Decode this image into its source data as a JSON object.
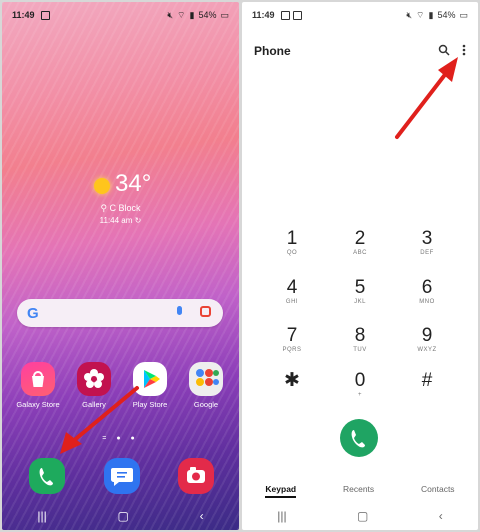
{
  "left": {
    "status": {
      "time": "11:49",
      "battery": "54%"
    },
    "weather": {
      "temp": "34°",
      "location": "C Block",
      "time": "11:44 am"
    },
    "apps": [
      {
        "label": "Galaxy Store",
        "icon": "galaxy-store-icon"
      },
      {
        "label": "Gallery",
        "icon": "gallery-icon"
      },
      {
        "label": "Play Store",
        "icon": "play-store-icon"
      },
      {
        "label": "Google",
        "icon": "google-folder-icon"
      }
    ],
    "dock": [
      {
        "icon": "phone-icon"
      },
      {
        "icon": "messages-icon"
      },
      {
        "icon": "camera-icon"
      }
    ],
    "search": {
      "logo": "G"
    }
  },
  "right": {
    "status": {
      "time": "11:49",
      "battery": "54%"
    },
    "title": "Phone",
    "keys": [
      {
        "num": "1",
        "letters": "QO"
      },
      {
        "num": "2",
        "letters": "ABC"
      },
      {
        "num": "3",
        "letters": "DEF"
      },
      {
        "num": "4",
        "letters": "GHI"
      },
      {
        "num": "5",
        "letters": "JKL"
      },
      {
        "num": "6",
        "letters": "MNO"
      },
      {
        "num": "7",
        "letters": "PQRS"
      },
      {
        "num": "8",
        "letters": "TUV"
      },
      {
        "num": "9",
        "letters": "WXYZ"
      },
      {
        "num": "✱",
        "letters": ""
      },
      {
        "num": "0",
        "letters": "+"
      },
      {
        "num": "#",
        "letters": ""
      }
    ],
    "tabs": [
      "Keypad",
      "Recents",
      "Contacts"
    ]
  },
  "colors": {
    "accent": "#e0201c",
    "call": "#1fa463",
    "phone_icon": "#1eaa5d"
  }
}
